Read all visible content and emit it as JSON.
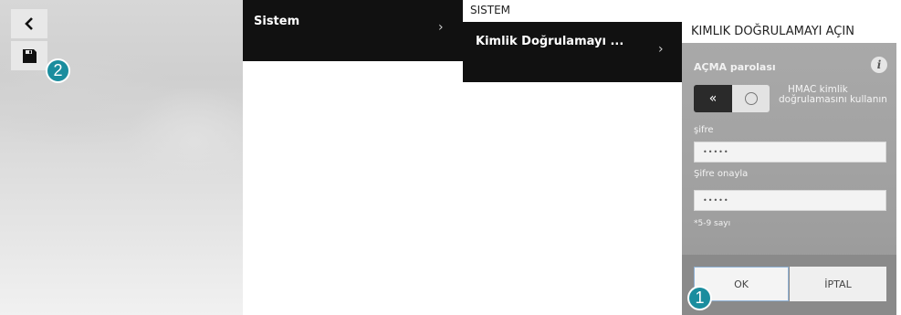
{
  "toolbar": {
    "back_icon": "chevron-left-icon",
    "save_icon": "floppy-disk-icon"
  },
  "callouts": [
    "2",
    "1"
  ],
  "menu": {
    "level1": {
      "label": "Sistem",
      "arrow": "›"
    },
    "level2": {
      "label": "Kimlik Doğrulamayı ...",
      "arrow": "›"
    }
  },
  "breadcrumb": "SISTEM",
  "dialog": {
    "title": "KIMLIK DOĞRULAMAYI AÇIN",
    "section_label": "AÇMA parolası",
    "info_icon": "i",
    "toggle": {
      "arrow": "«",
      "text": "HMAC kimlik doğrulamasını kullanın"
    },
    "password_label": "şifre",
    "password_value": "•••••",
    "confirm_label": "Şifre onayla",
    "confirm_value": "•••••",
    "hint": "*5-9 sayı",
    "ok_label": "OK",
    "cancel_label": "İPTAL"
  },
  "colors": {
    "callout": "#1a8d9e",
    "menu_bg": "#111111",
    "dialog_bg": "#a9a9a9"
  }
}
